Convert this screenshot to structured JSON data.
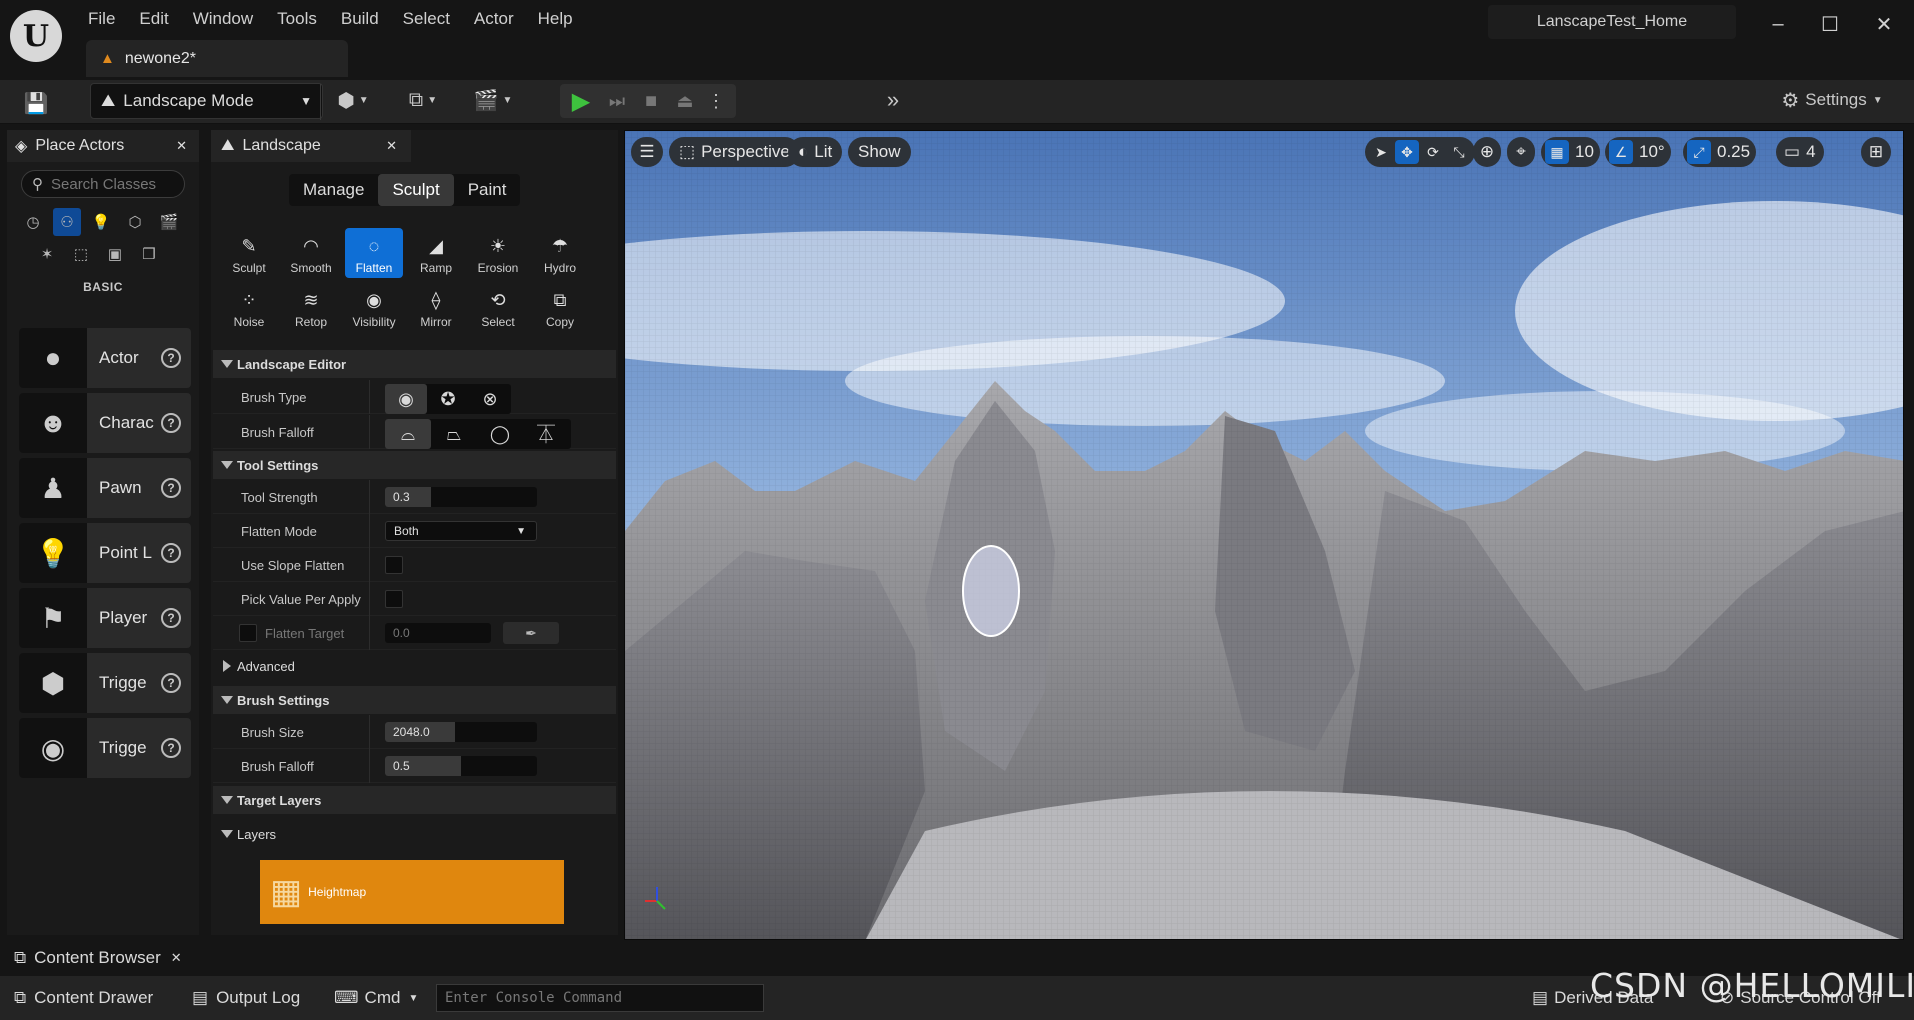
{
  "menu": [
    "File",
    "Edit",
    "Window",
    "Tools",
    "Build",
    "Select",
    "Actor",
    "Help"
  ],
  "logo_text": "U",
  "doc_tab": "newone2*",
  "project_name": "LanscapeTest_Home",
  "window_controls": {
    "minimize": "–",
    "maximize": "☐",
    "close": "✕"
  },
  "toolbar": {
    "mode_label": "Landscape Mode",
    "settings_label": "Settings"
  },
  "place_actors": {
    "tab_label": "Place Actors",
    "search_placeholder": "Search Classes",
    "category_label": "BASIC",
    "items": [
      {
        "label": "Actor",
        "icon": "sphere-icon"
      },
      {
        "label": "Charac",
        "icon": "character-icon"
      },
      {
        "label": "Pawn",
        "icon": "pawn-icon"
      },
      {
        "label": "Point L",
        "icon": "lightbulb-icon"
      },
      {
        "label": "Player",
        "icon": "player-start-icon"
      },
      {
        "label": "Trigge",
        "icon": "trigger-box-icon"
      },
      {
        "label": "Trigge",
        "icon": "trigger-sphere-icon"
      }
    ]
  },
  "landscape": {
    "tab_label": "Landscape",
    "modes": [
      "Manage",
      "Sculpt",
      "Paint"
    ],
    "active_mode": "Sculpt",
    "tools": [
      {
        "label": "Sculpt",
        "glyph": "✎"
      },
      {
        "label": "Smooth",
        "glyph": "◠"
      },
      {
        "label": "Flatten",
        "glyph": "◌"
      },
      {
        "label": "Ramp",
        "glyph": "◢"
      },
      {
        "label": "Erosion",
        "glyph": "☀"
      },
      {
        "label": "Hydro",
        "glyph": "☂"
      },
      {
        "label": "Noise",
        "glyph": "⁘"
      },
      {
        "label": "Retop",
        "glyph": "≋"
      },
      {
        "label": "Visibility",
        "glyph": "◉"
      },
      {
        "label": "Mirror",
        "glyph": "⟠"
      },
      {
        "label": "Select",
        "glyph": "⟲"
      },
      {
        "label": "Copy",
        "glyph": "⧉"
      }
    ],
    "selected_tool": "Flatten",
    "sections": {
      "editor": "Landscape Editor",
      "tool_settings": "Tool Settings",
      "advanced": "Advanced",
      "brush_settings": "Brush Settings",
      "target_layers": "Target Layers",
      "layers": "Layers"
    },
    "brush_type_label": "Brush Type",
    "brush_falloff_type_label": "Brush Falloff",
    "tool_strength_label": "Tool Strength",
    "tool_strength_value": "0.3",
    "tool_strength_fraction": 0.3,
    "flatten_mode_label": "Flatten Mode",
    "flatten_mode_value": "Both",
    "use_slope_flatten_label": "Use Slope Flatten",
    "pick_value_label": "Pick Value Per Apply",
    "flatten_target_label": "Flatten Target",
    "flatten_target_value": "0.0",
    "brush_size_label": "Brush Size",
    "brush_size_value": "2048.0",
    "brush_falloff_label": "Brush Falloff",
    "brush_falloff_value": "0.5",
    "heightmap_label": "Heightmap"
  },
  "viewport": {
    "perspective": "Perspective",
    "lit": "Lit",
    "show": "Show",
    "grid_snap": "10",
    "rot_snap": "10°",
    "scale_snap": "0.25",
    "cam_speed": "4"
  },
  "bottom": {
    "content_browser_tab": "Content Browser",
    "content_drawer": "Content Drawer",
    "output_log": "Output Log",
    "cmd": "Cmd",
    "console_placeholder": "Enter Console Command",
    "derived_data": "Derived Data",
    "source_control": "Source Control Off"
  },
  "watermark": "CSDN @HELLOMILI",
  "colors": {
    "accent": "#0f6fd6",
    "heightmap": "#e0870e",
    "play": "#3ec23e"
  }
}
